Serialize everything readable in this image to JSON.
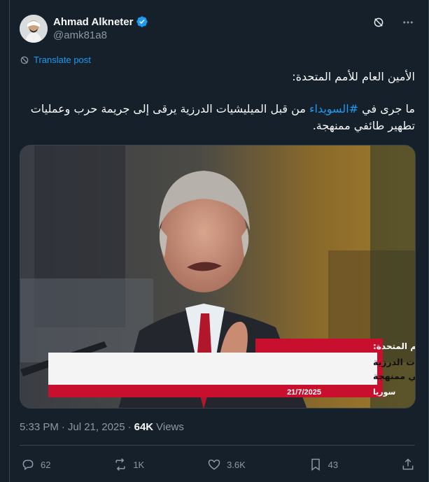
{
  "author": {
    "name": "Ahmad Alkneter",
    "handle": "@amk81a8"
  },
  "translate_label": "Translate post",
  "tweet": {
    "line1": "الأمين العام للأمم المتحدة:",
    "line2_prefix": "ما جرى في ",
    "hashtag": "#السويداء",
    "line2_suffix": " من قبل الميليشيات الدرزية يرقى إلى جريمة حرب وعمليات",
    "line3": "تطهير طائفي ممنهجة."
  },
  "media": {
    "caption_header": "الأمين العام للأمم المتحدة:",
    "caption_line1": "ما جرى في السويداء من قبل الميليشيات الدرزية",
    "caption_line2": "يرقى إلى جريمة حرب وعمليات تطهير طائفي ممنهجة",
    "caption_date": "21/7/2025",
    "caption_source": "سوريا"
  },
  "meta": {
    "time": "5:33 PM",
    "separator": "·",
    "date": "Jul 21, 2025",
    "views_count": "64K",
    "views_label": "Views"
  },
  "actions": {
    "replies": "62",
    "reposts": "1K",
    "likes": "3.6K",
    "bookmarks": "43"
  },
  "colors": {
    "background": "#15202b",
    "accent": "#1d9bf0",
    "muted": "#8b98a5",
    "caption_red": "#c8102e"
  },
  "icons": [
    "verified-badge-icon",
    "grok-icon",
    "more-icon",
    "translate-icon",
    "reply-icon",
    "repost-icon",
    "like-icon",
    "bookmark-icon",
    "share-icon"
  ]
}
